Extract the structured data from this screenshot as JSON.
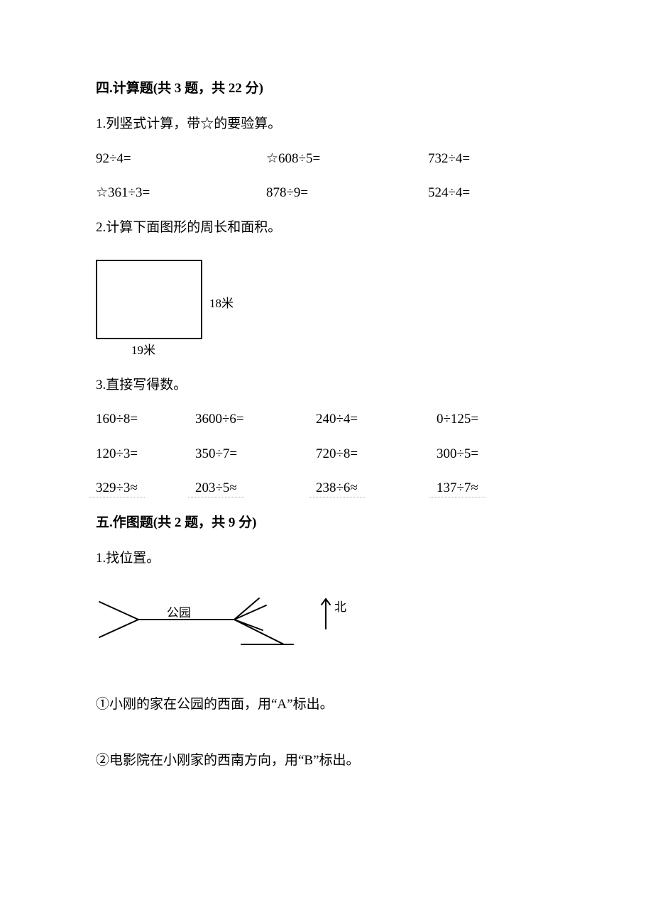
{
  "section4": {
    "header": "四.计算题(共 3 题，共 22 分)",
    "q1": {
      "prompt": "1.列竖式计算，带☆的要验算。",
      "row1": {
        "c1": "92÷4=",
        "c2": "☆608÷5=",
        "c3": "732÷4="
      },
      "row2": {
        "c1": "☆361÷3=",
        "c2": "878÷9=",
        "c3": "524÷4="
      }
    },
    "q2": {
      "prompt": "2.计算下面图形的周长和面积。",
      "rightLabel": "18米",
      "bottomLabel": "19米"
    },
    "q3": {
      "prompt": "3.直接写得数。",
      "row1": {
        "c1": "160÷8=",
        "c2": "3600÷6=",
        "c3": "240÷4=",
        "c4": "0÷125="
      },
      "row2": {
        "c1": "120÷3=",
        "c2": "350÷7=",
        "c3": "720÷8=",
        "c4": "300÷5="
      },
      "row3": {
        "c1": "329÷3≈",
        "c2": "203÷5≈",
        "c3": "238÷6≈",
        "c4": "137÷7≈"
      }
    }
  },
  "section5": {
    "header": "五.作图题(共 2 题，共 9 分)",
    "q1": {
      "prompt": "1.找位置。",
      "parkLabel": "公园",
      "northLabel": "北",
      "sub1": "①小刚的家在公园的西面，用“A”标出。",
      "sub2": "②电影院在小刚家的西南方向，用“B”标出。"
    }
  }
}
